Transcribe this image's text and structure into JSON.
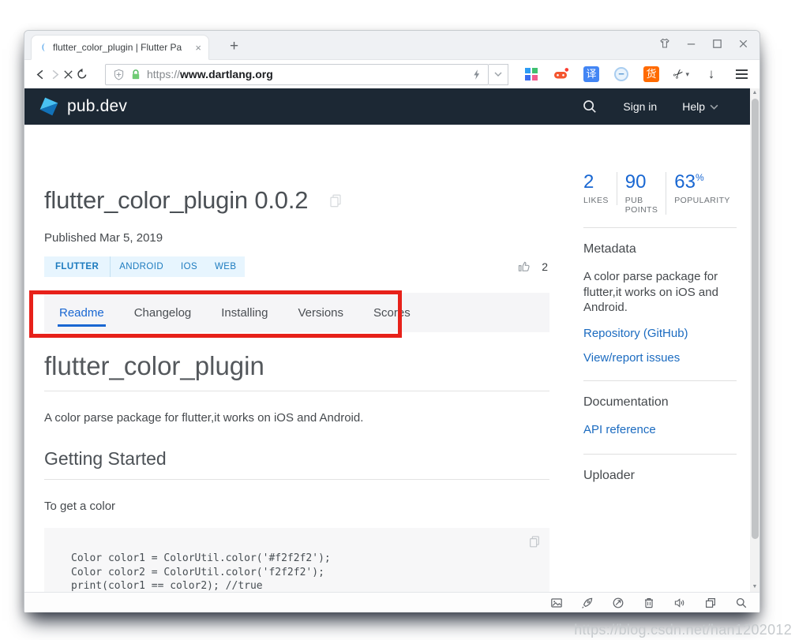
{
  "watermark": "https://blog.csdn.net/han1202012",
  "colors": {
    "header_bg": "#1c2834",
    "accent_blue": "#1967d2",
    "link_blue": "#1b6bc0",
    "badge_bg": "#e7f5fe",
    "badge_text": "#1d7bbf",
    "annotation_red": "#e7211a",
    "code_bg": "#f7f7f8"
  },
  "browser": {
    "tab": {
      "favicon": "blue-crescent-icon",
      "title": "flutter_color_plugin | Flutter Pa",
      "close_glyph": "×"
    },
    "new_tab_glyph": "+",
    "window_controls": [
      "skin-shirt-icon",
      "minimize-icon",
      "maximize-icon",
      "close-icon"
    ],
    "nav_icons": [
      "back-icon",
      "forward-icon",
      "stop-icon",
      "reload-icon"
    ],
    "address_bar": {
      "shield_icon": "shield-plus-icon",
      "lock_icon": "green-lock-icon",
      "protocol": "https://",
      "host": "www.dartlang.org",
      "bolt_icon": "lightning-icon",
      "dropdown_icon": "chevron-down-icon"
    },
    "toolbar_glyphs": {
      "translate": "译",
      "shopping": "货",
      "minus": "−",
      "scissors": "✂",
      "caret": "▾",
      "download": "↓"
    },
    "extension_icons": [
      "apps-grid-icon",
      "gamepad-icon",
      "translate-icon",
      "minus-circle-icon",
      "shopping-icon",
      "scissors-icon",
      "download-icon",
      "menu-icon"
    ]
  },
  "site": {
    "brand": "pub.dev",
    "nav": {
      "sign_in": "Sign in",
      "help": "Help"
    },
    "package": {
      "title": "flutter_color_plugin 0.0.2",
      "published": "Published Mar 5, 2019",
      "badges": [
        "FLUTTER",
        "ANDROID",
        "IOS",
        "WEB"
      ],
      "likes": "2"
    },
    "tabs": [
      "Readme",
      "Changelog",
      "Installing",
      "Versions",
      "Scores"
    ],
    "active_tab": "Readme",
    "stats": [
      {
        "value": "2",
        "label": "LIKES"
      },
      {
        "value": "90",
        "label": "PUB POINTS"
      },
      {
        "value": "63",
        "suffix": "%",
        "label": "POPULARITY"
      }
    ],
    "sidebar": {
      "metadata_title": "Metadata",
      "description": "A color parse package for flutter,it works on iOS and Android.",
      "repository_link": "Repository (GitHub)",
      "issues_link": "View/report issues",
      "documentation_title": "Documentation",
      "api_link": "API reference",
      "uploader_title": "Uploader"
    },
    "readme": {
      "heading": "flutter_color_plugin",
      "description": "A color parse package for flutter,it works on iOS and Android.",
      "section_heading": "Getting Started",
      "paragraph": "To get a color",
      "code": [
        "Color color1 = ColorUtil.color('#f2f2f2');",
        "Color color2 = ColorUtil.color('f2f2f2');",
        "print(color1 == color2); //true"
      ]
    },
    "statusbar_icons": [
      "screenshot-icon",
      "rocket-boost-icon",
      "refresh-circle-icon",
      "trash-icon",
      "volume-icon",
      "restore-window-icon",
      "find-icon"
    ]
  }
}
